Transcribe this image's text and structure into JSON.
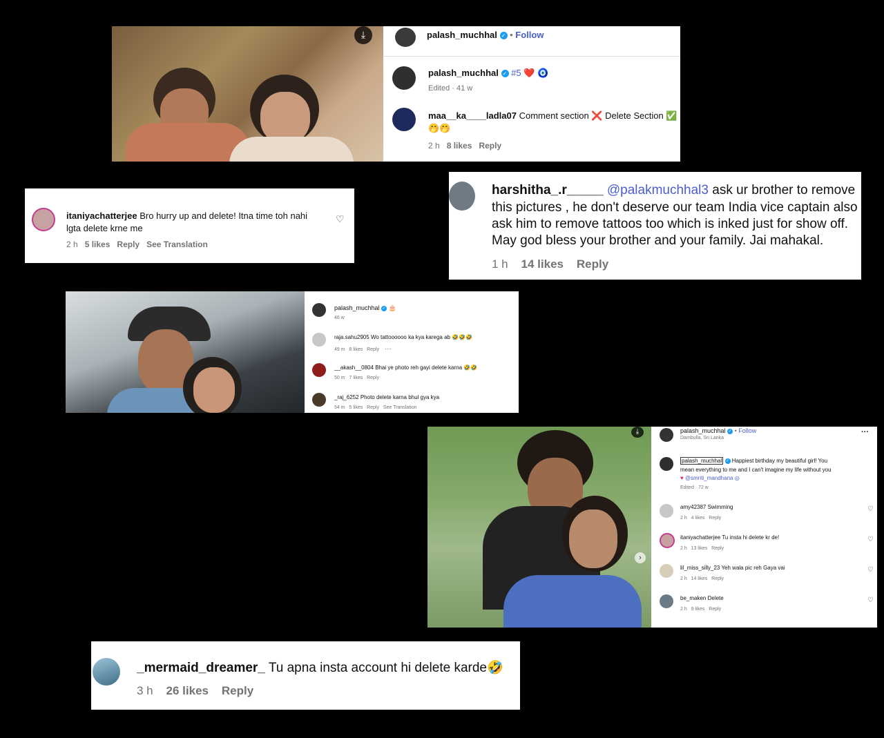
{
  "screens": {
    "s1": {
      "header_user": "palash_muchhal",
      "follow": "Follow",
      "post_user": "palash_muchhal",
      "post_caption": "#5",
      "post_emoji": "❤️ 🧿",
      "post_meta": "Edited · 41 w",
      "comment_user": "maa__ka____ladla07",
      "comment_text": "Comment section ❌ Delete Section ✅",
      "comment_text2": "🤭🤭",
      "comment_time": "2 h",
      "comment_likes": "8 likes",
      "comment_reply": "Reply"
    },
    "s2": {
      "user": "itaniyachatterjee",
      "text1": "Bro hurry up and delete! Itna time toh nahi",
      "text2": "lgta delete krne me",
      "time": "2 h",
      "likes": "5 likes",
      "reply": "Reply",
      "translate": "See Translation"
    },
    "s3": {
      "user": "harshitha_.r_____",
      "mention": "@palakmuchhal3",
      "line1": "ask ur brother to remove",
      "line2": "this pictures , he don't deserve our team India vice captain also",
      "line3": "ask him to remove tattoos too which is inked just for show off.",
      "line4": "May god bless your brother and your family. Jai mahakal.",
      "time": "1 h",
      "likes": "14 likes",
      "reply": "Reply"
    },
    "s4": {
      "post_user": "palash_muchhal",
      "post_emoji": "🎂",
      "post_meta": "46 w",
      "comments": [
        {
          "user": "raja.sahu2905",
          "text": "Wo tattoooooo ka kya karega ab 🤣🤣🤣",
          "time": "49 m",
          "likes": "8 likes",
          "reply": "Reply",
          "extra": "···"
        },
        {
          "user": "__akash__0804",
          "text": "Bhai ye photo reh gayi delete karna 🤣🤣",
          "time": "50 m",
          "likes": "7 likes",
          "reply": "Reply",
          "extra": ""
        },
        {
          "user": "_raj_6252",
          "text": "Photo delete karna bhul gya kya",
          "time": "54 m",
          "likes": "5 likes",
          "reply": "Reply",
          "extra": "See Translation"
        }
      ]
    },
    "s5": {
      "header_user": "palash_muchhal",
      "follow": "Follow",
      "location": "Dambulla, Sri Lanka",
      "more": "···",
      "post_user": "palash_muchhal",
      "post_line1": "Happiest birthday my beautiful girl! You",
      "post_line2": "mean everything to me and I can't imagine my life without you",
      "post_mention": "@smriti_mandhana",
      "post_meta": "Edited · 72 w",
      "comments": [
        {
          "user": "amy42387",
          "text": "Swimming",
          "time": "2 h",
          "likes": "4 likes",
          "reply": "Reply"
        },
        {
          "user": "itaniyachatterjee",
          "text": "Tu insta hi delete kr de!",
          "time": "2 h",
          "likes": "13 likes",
          "reply": "Reply"
        },
        {
          "user": "lil_miss_silly_23",
          "text": "Yeh wala pic reh Gaya vai",
          "time": "2 h",
          "likes": "14 likes",
          "reply": "Reply"
        },
        {
          "user": "be_maken",
          "text": "Delete",
          "time": "2 h",
          "likes": "9 likes",
          "reply": "Reply"
        }
      ]
    },
    "s6": {
      "user": "_mermaid_dreamer_",
      "text": "Tu apna insta account hi delete karde🤣",
      "time": "3 h",
      "likes": "26 likes",
      "reply": "Reply"
    }
  },
  "icons": {
    "download": "download-icon",
    "heart": "heart-icon",
    "verified": "verified-badge-icon",
    "next": "chevron-right-icon"
  },
  "colors": {
    "background": "#000000",
    "link": "#4a5dcf",
    "verified": "#1d9bf0"
  }
}
